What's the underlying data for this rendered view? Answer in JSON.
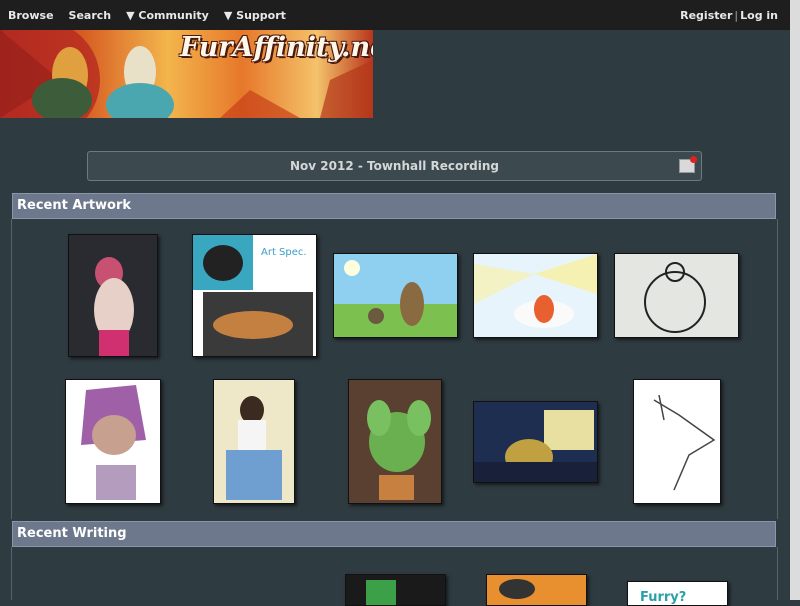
{
  "nav": {
    "browse": "Browse",
    "search": "Search",
    "community": "▼ Community",
    "support": "▼ Support",
    "register": "Register",
    "separator": "|",
    "login": "Log in"
  },
  "banner": {
    "logo_text": "FurAffinity.net"
  },
  "announcement": {
    "title": "Nov 2012 - Townhall Recording"
  },
  "sections": {
    "recent_artwork": "Recent Artwork",
    "recent_writing": "Recent Writing"
  }
}
